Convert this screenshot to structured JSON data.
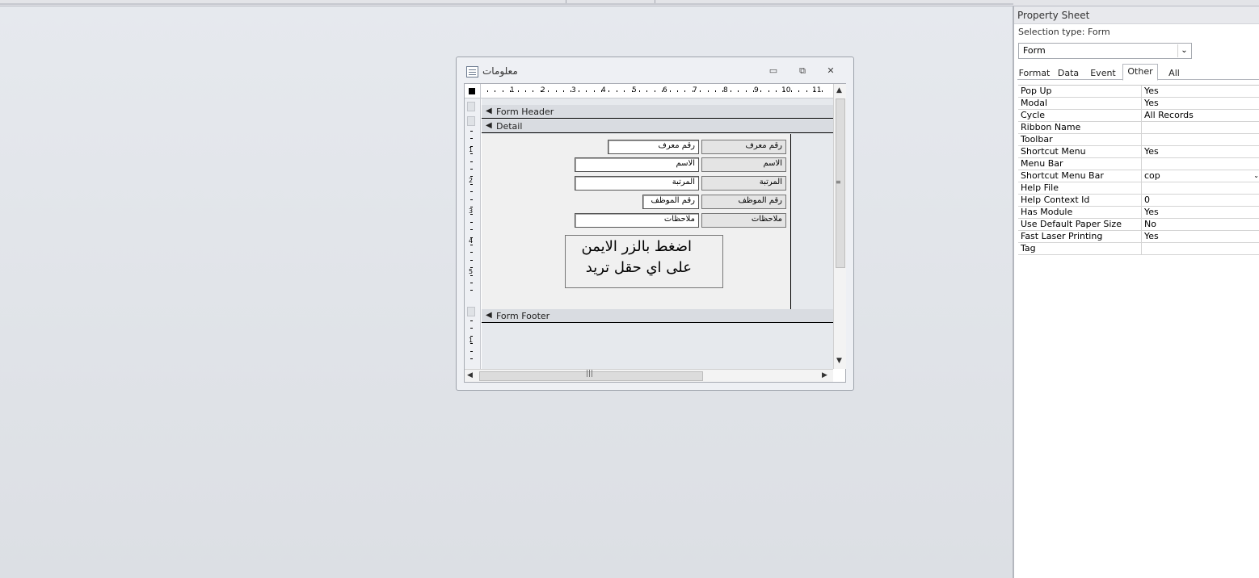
{
  "form_window": {
    "title": "معلومات",
    "minimize": "▭",
    "restore": "⧉",
    "close": "✕",
    "ruler_numbers": [
      "1",
      "2",
      "3",
      "4",
      "5",
      "6",
      "7",
      "8",
      "9",
      "10",
      "11"
    ],
    "vruler_numbers": [
      "1",
      "2",
      "3",
      "4",
      "5",
      "1"
    ],
    "sections": {
      "form_header": "Form Header",
      "detail": "Detail",
      "form_footer": "Form Footer"
    },
    "fields": [
      {
        "label": "رقم معرف",
        "box": "رقم معرف"
      },
      {
        "label": "الاسم",
        "box": "الاسم"
      },
      {
        "label": "المرتبة",
        "box": "المرتبة"
      },
      {
        "label": "رقم الموظف",
        "box": "رقم الموظف"
      },
      {
        "label": "ملاحظات",
        "box": "ملاحظات"
      }
    ],
    "note_line1": "اضغط بالزر الايمن",
    "note_line2": "على اي حقل تريد"
  },
  "property_sheet": {
    "title": "Property Sheet",
    "selection_type": "Selection type:  Form",
    "selected_object": "Form",
    "tabs": [
      "Format",
      "Data",
      "Event",
      "Other",
      "All"
    ],
    "active_tab": "Other",
    "rows": [
      {
        "name": "Pop Up",
        "value": "Yes"
      },
      {
        "name": "Modal",
        "value": "Yes"
      },
      {
        "name": "Cycle",
        "value": "All Records"
      },
      {
        "name": "Ribbon Name",
        "value": ""
      },
      {
        "name": "Toolbar",
        "value": ""
      },
      {
        "name": "Shortcut Menu",
        "value": "Yes"
      },
      {
        "name": "Menu Bar",
        "value": ""
      },
      {
        "name": "Shortcut Menu Bar",
        "value": "cop"
      },
      {
        "name": "Help File",
        "value": ""
      },
      {
        "name": "Help Context Id",
        "value": "0"
      },
      {
        "name": "Has Module",
        "value": "Yes"
      },
      {
        "name": "Use Default Paper Size",
        "value": "No"
      },
      {
        "name": "Fast Laser Printing",
        "value": "Yes"
      },
      {
        "name": "Tag",
        "value": ""
      }
    ]
  }
}
